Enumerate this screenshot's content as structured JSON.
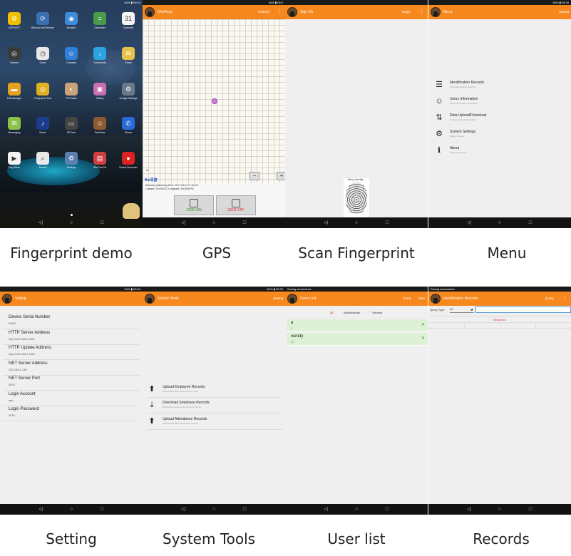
{
  "status": {
    "left_home": "",
    "right_home": "84% ▮ 09:34",
    "right_gps": "84% ▮ 09:3",
    "saving": "Saving screenshot..."
  },
  "home": {
    "apps": [
      {
        "label": "ASR MOT",
        "icon": "asr-icon",
        "color": "#f0c000",
        "glyph": "⚙"
      },
      {
        "label": "Backup and Restore",
        "icon": "backup-icon",
        "color": "#3a6fb0",
        "glyph": "⟳"
      },
      {
        "label": "Browser",
        "icon": "browser-icon",
        "color": "#3c8ad8",
        "glyph": "◉"
      },
      {
        "label": "Calculator",
        "icon": "calculator-icon",
        "color": "#4a9a4a",
        "glyph": "="
      },
      {
        "label": "Calendar",
        "icon": "calendar-icon",
        "color": "#f4f4f4",
        "glyph": "31"
      },
      {
        "label": "Camera",
        "icon": "camera-icon",
        "color": "#3a3a3a",
        "glyph": "◎"
      },
      {
        "label": "Clock",
        "icon": "clock-icon",
        "color": "#e8e8e8",
        "glyph": "◷"
      },
      {
        "label": "Contacts",
        "icon": "contacts-icon",
        "color": "#2f7fd6",
        "glyph": "☺"
      },
      {
        "label": "Downloads",
        "icon": "downloads-icon",
        "color": "#2aa3e0",
        "glyph": "↓"
      },
      {
        "label": "Email",
        "icon": "email-icon",
        "color": "#e8c14a",
        "glyph": "✉"
      },
      {
        "label": "File Manager",
        "icon": "file-manager-icon",
        "color": "#e5a020",
        "glyph": "▬"
      },
      {
        "label": "Fingerprint Test",
        "icon": "fingerprint-icon",
        "color": "#e0b020",
        "glyph": "◎"
      },
      {
        "label": "FM Radio",
        "icon": "radio-icon",
        "color": "#c9a27a",
        "glyph": "◐"
      },
      {
        "label": "Gallery",
        "icon": "gallery-icon",
        "color": "#c86fb0",
        "glyph": "▣"
      },
      {
        "label": "Google Settings",
        "icon": "google-settings-icon",
        "color": "#6a7a8a",
        "glyph": "⚙"
      },
      {
        "label": "Messaging",
        "icon": "messaging-icon",
        "color": "#8bc34a",
        "glyph": "✉"
      },
      {
        "label": "Music",
        "icon": "music-icon",
        "color": "#1e3c8c",
        "glyph": "♪"
      },
      {
        "label": "NFCard",
        "icon": "nfc-icon",
        "color": "#444444",
        "glyph": "▭"
      },
      {
        "label": "OnePass",
        "icon": "onepass-icon",
        "color": "#8a5a30",
        "glyph": "☺"
      },
      {
        "label": "Phone",
        "icon": "phone-icon",
        "color": "#2a6ad8",
        "glyph": "✆"
      },
      {
        "label": "Play Store",
        "icon": "play-store-icon",
        "color": "#f2f2f2",
        "glyph": "▶"
      },
      {
        "label": "Search",
        "icon": "search-icon",
        "color": "#e8e8e8",
        "glyph": "⌕"
      },
      {
        "label": "Settings",
        "icon": "settings-icon",
        "color": "#5a7fb0",
        "glyph": "⚙"
      },
      {
        "label": "SIM Tool Kit",
        "icon": "sim-icon",
        "color": "#d04040",
        "glyph": "▤"
      },
      {
        "label": "Sound Recorder",
        "icon": "recorder-icon",
        "color": "#d22",
        "glyph": "●"
      }
    ]
  },
  "gps": {
    "title": "OnePass",
    "action": "Refresh",
    "scale": "50",
    "baidu": "Bai百度",
    "info_line1": "Network positioning  Time: 2017-03-21 17:34:18",
    "info_line2": "Latitude: 29.609412  Longitude: 106.559792",
    "sign_on": "SIGN ON",
    "sign_off": "SIGN OFF",
    "zoom_out": "−",
    "zoom_in": "+"
  },
  "scan": {
    "title": "Sign On",
    "action": "Begin",
    "status": "Being Identify..."
  },
  "menu": {
    "title": "Menu",
    "action": "Setting",
    "items": [
      {
        "title": "Identification Records",
        "sub": "View Identification Records",
        "icon": "list-icon",
        "glyph": "☰"
      },
      {
        "title": "Users Information",
        "sub": "Users Information Information",
        "icon": "users-icon",
        "glyph": "☺"
      },
      {
        "title": "Data Upload/Donwload",
        "sub": "Upload and Download Data",
        "icon": "sync-icon",
        "glyph": "⇅"
      },
      {
        "title": "System Settings",
        "sub": "Setting System",
        "icon": "gear-icon",
        "glyph": "⚙"
      },
      {
        "title": "About",
        "sub": "About this System",
        "icon": "info-icon",
        "glyph": "ℹ"
      }
    ]
  },
  "setting": {
    "title": "Setting",
    "items": [
      {
        "label": "Device Serial Number",
        "value": "00001"
      },
      {
        "label": "HTTP Server Address",
        "value": "http://192.168.1.138/"
      },
      {
        "label": "HTTP Update Address",
        "value": "http://192.168.1.138/"
      },
      {
        "label": "NET Server Address",
        "value": "192.168.1.136"
      },
      {
        "label": "NET Server Port",
        "value": "5002"
      },
      {
        "label": "Login Account",
        "value": "apk"
      },
      {
        "label": "Login Password",
        "value": "1010"
      }
    ]
  },
  "tools": {
    "title": "System Tools",
    "action": "Setting",
    "items": [
      {
        "title": "Upload Employee Records",
        "sub": "Upload all employee records to server",
        "icon": "upload-icon",
        "glyph": "⬆"
      },
      {
        "title": "Download Employee Records",
        "sub": "Download employee records from Server",
        "icon": "download-icon",
        "glyph": "⤓"
      },
      {
        "title": "Upload Attendance Records",
        "sub": "Upload Attendance Records to server",
        "icon": "upload-icon",
        "glyph": "⬆"
      }
    ]
  },
  "users": {
    "title": "Users List",
    "action1": "Enrol",
    "action2": "View",
    "tabs": [
      "All",
      "Administrator",
      "General"
    ],
    "list": [
      {
        "name": "a",
        "id": "0"
      },
      {
        "name": "wendy",
        "id": "01"
      }
    ]
  },
  "records": {
    "title": "Identification Records",
    "action": "Query",
    "query_label": "Query Type",
    "query_value": "All",
    "records_count": "Records:0"
  },
  "captions": [
    "Fingerprint demo",
    "GPS",
    "Scan Fingerprint",
    "Menu",
    "Setting",
    "System Tools",
    "User list",
    "Records"
  ],
  "nav": {
    "back": "◁",
    "home": "○",
    "recent": "□"
  }
}
